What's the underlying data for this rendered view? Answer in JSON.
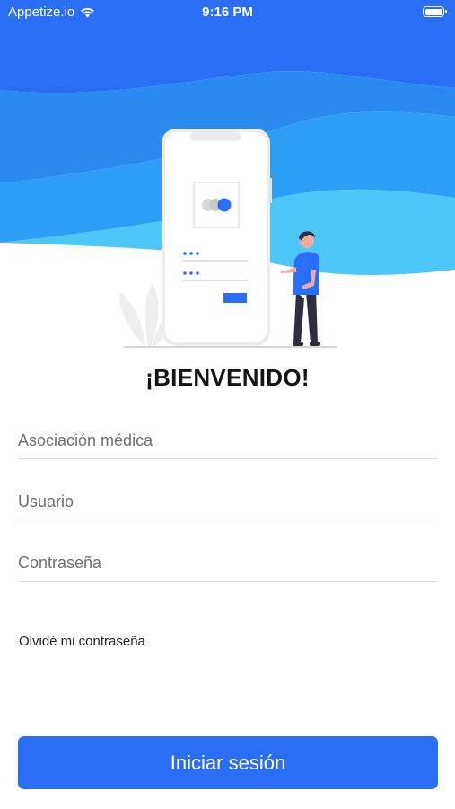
{
  "status_bar": {
    "carrier": "Appetize.io",
    "time": "9:16 PM",
    "wifi_icon": "wifi-icon",
    "battery_icon": "battery-icon"
  },
  "illustration": {
    "description_icon": "login-illustration",
    "colors": {
      "wave_dark": "#2b6ef6",
      "wave_mid": "#2a8af2",
      "wave_light": "#4cc7f7",
      "accent": "#2b6ef6"
    }
  },
  "welcome": "¡BIENVENIDO!",
  "form": {
    "association_placeholder": "Asociación médica",
    "user_placeholder": "Usuario",
    "password_placeholder": "Contraseña"
  },
  "forgot_password": "Olvidé mi contraseña",
  "login_button": "Iniciar sesión"
}
